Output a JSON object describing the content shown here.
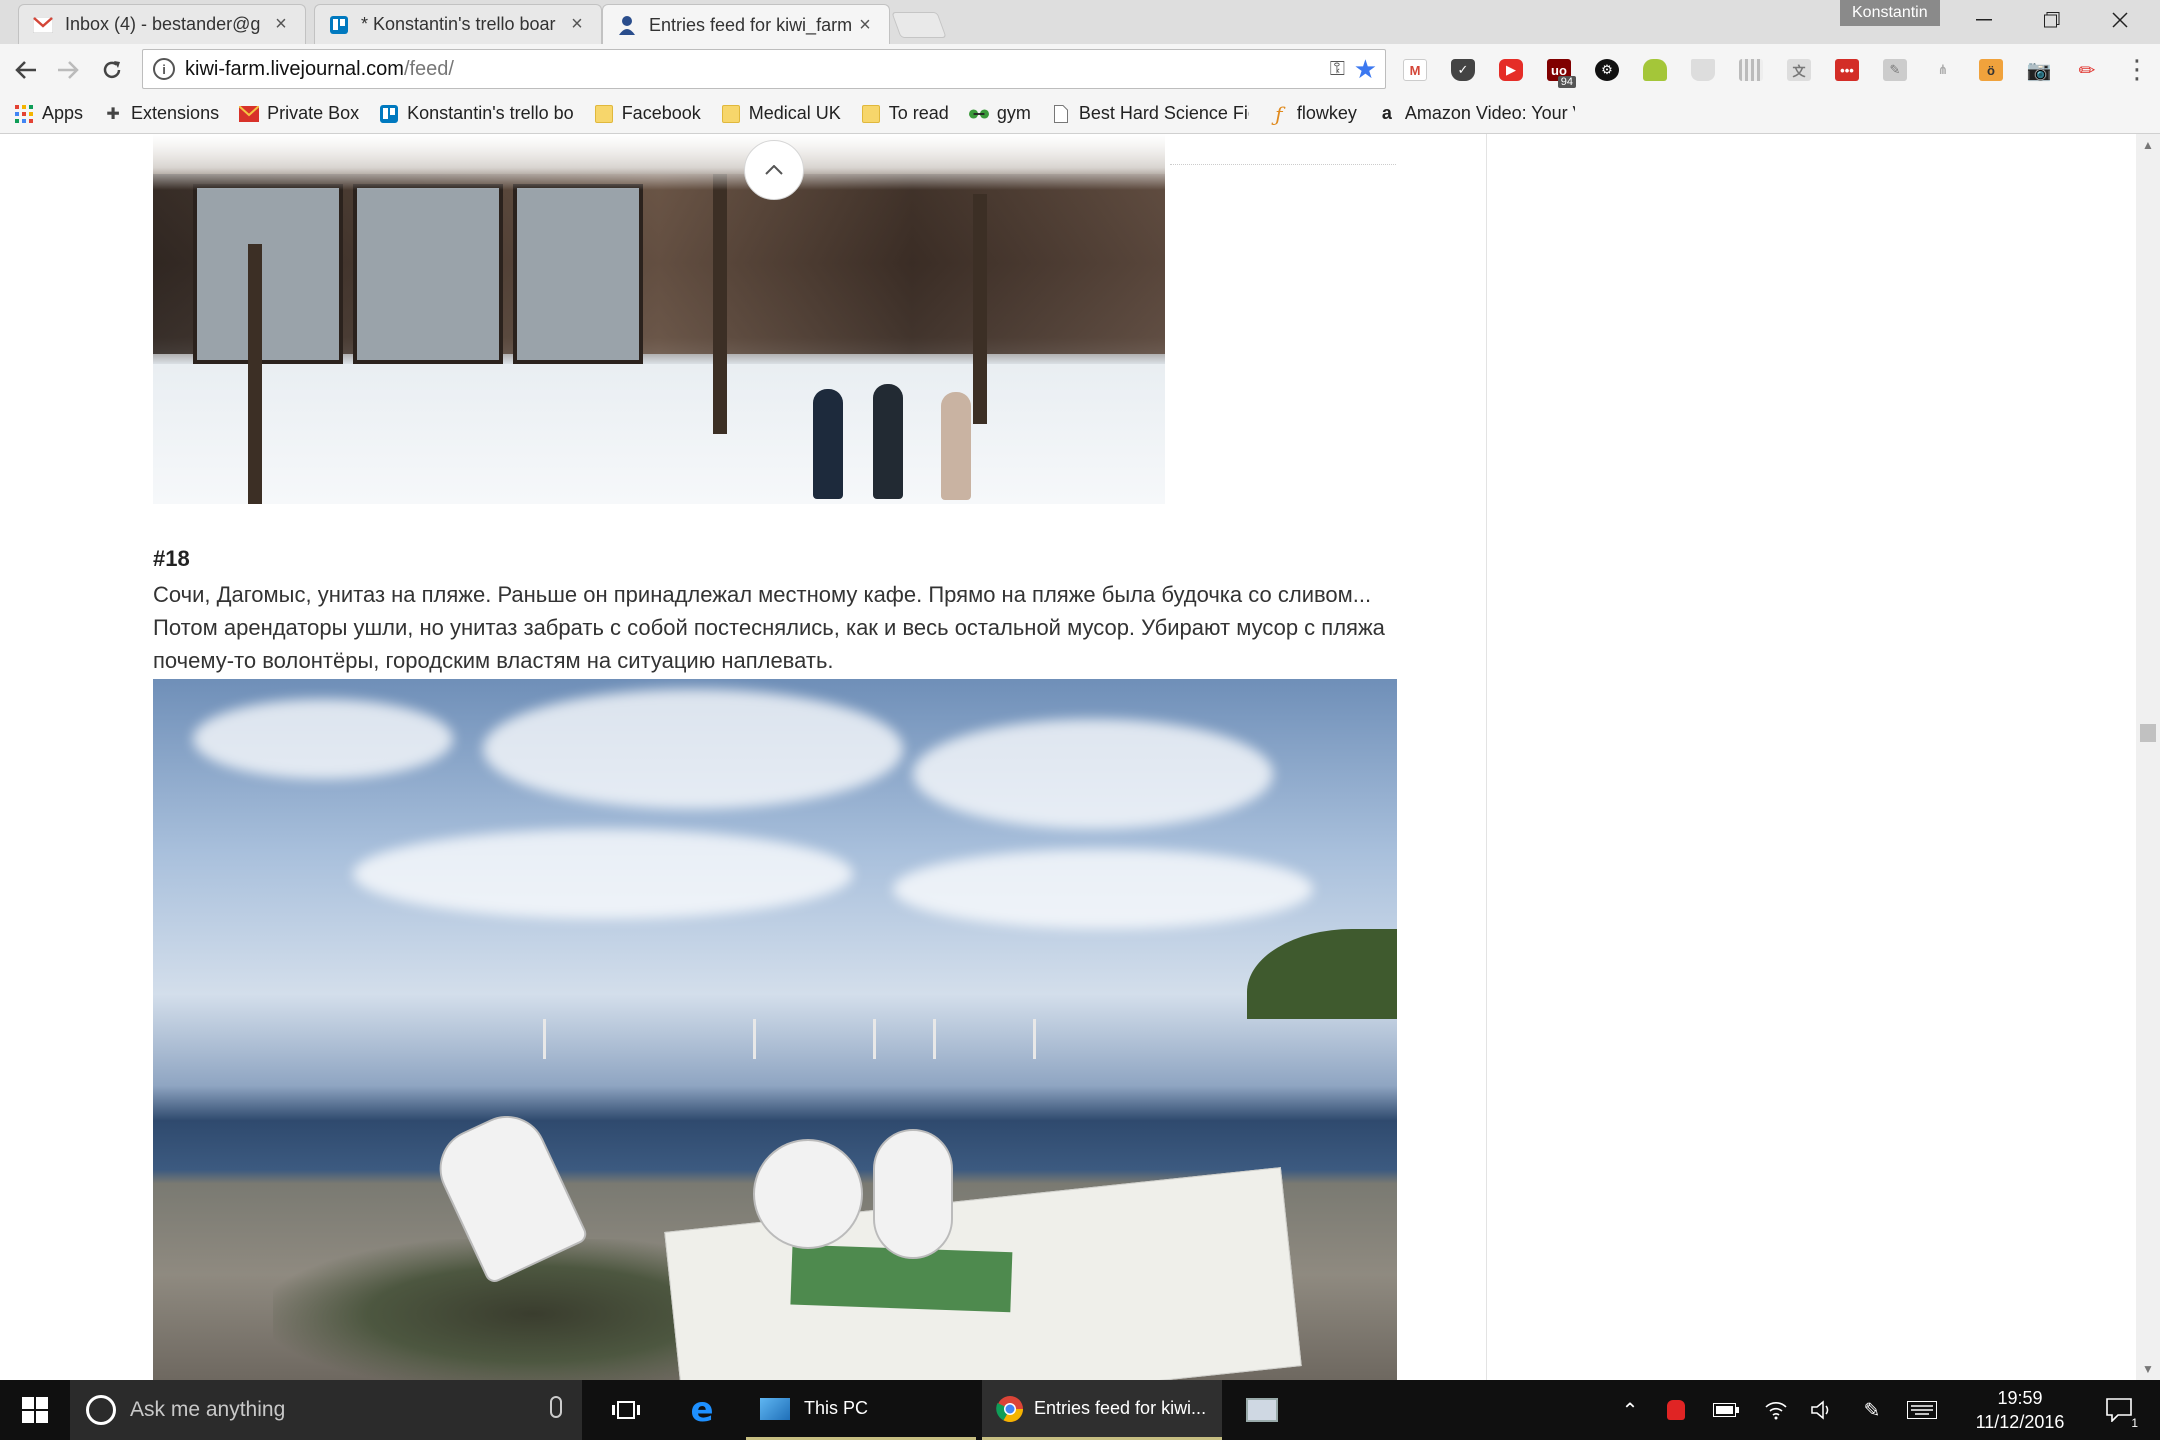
{
  "browser": {
    "tabs": [
      {
        "title": "Inbox (4) - bestander@g",
        "icon": "gmail-icon"
      },
      {
        "title": "* Konstantin's trello boar",
        "icon": "trello-icon"
      },
      {
        "title": "Entries feed for kiwi_farm",
        "icon": "livejournal-user-icon"
      }
    ],
    "profile_name": "Konstantin",
    "url_host": "kiwi-farm.livejournal.com",
    "url_path": "/feed/",
    "extension_badge": "94",
    "accent_color": "#3c78f0"
  },
  "bookmarks": [
    {
      "label": "Apps",
      "icon": "apps-grid-icon"
    },
    {
      "label": "Extensions",
      "icon": "puzzle-piece-icon"
    },
    {
      "label": "Private Box",
      "icon": "envelope-icon"
    },
    {
      "label": "Konstantin's trello bo",
      "icon": "trello-icon"
    },
    {
      "label": "Facebook",
      "icon": "folder-icon"
    },
    {
      "label": "Medical UK",
      "icon": "folder-icon"
    },
    {
      "label": "To read",
      "icon": "folder-icon"
    },
    {
      "label": "gym",
      "icon": "gym-icon"
    },
    {
      "label": "Best Hard Science Fict",
      "icon": "page-icon"
    },
    {
      "label": "flowkey",
      "icon": "flowkey-icon"
    },
    {
      "label": "Amazon Video: Your V",
      "icon": "amazon-icon"
    }
  ],
  "post": {
    "entry_number": "#18",
    "text": "Сочи, Дагомыс, унитаз на пляже. Раньше он принадлежал местному кафе. Прямо на пляже была будочка со сливом... Потом арендаторы ушли, но унитаз забрать с собой постеснялись, как и весь остальной мусор. Убирают мусор с пляжа почему-то волонтёры, городским властям на ситуацию наплевать."
  },
  "taskbar": {
    "search_placeholder": "Ask me anything",
    "items": [
      {
        "label": "This PC",
        "icon": "explorer-icon"
      },
      {
        "label": "Entries feed for kiwi...",
        "icon": "chrome-icon"
      }
    ],
    "time": "19:59",
    "date": "11/12/2016",
    "notification_count": "1"
  }
}
